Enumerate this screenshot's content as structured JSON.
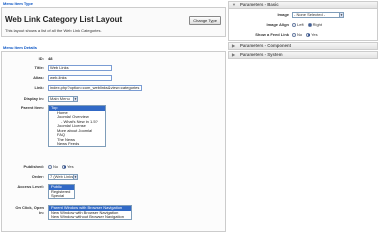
{
  "menu_item_type": {
    "section_title": "Menu Item Type",
    "heading": "Web Link Category List Layout",
    "change_button": "Change Type",
    "description": "This layout shows a list of all the Web Link Categories."
  },
  "menu_item_details": {
    "section_title": "Menu Item Details",
    "id": {
      "label": "ID:",
      "value": "48"
    },
    "title": {
      "label": "Title:",
      "value": "Web Links"
    },
    "alias": {
      "label": "Alias:",
      "value": "web-links"
    },
    "link": {
      "label": "Link:",
      "value": "index.php?option=com_weblinks&view=categories"
    },
    "display_in": {
      "label": "Display in:",
      "value": "Main Menu"
    },
    "parent_item": {
      "label": "Parent Item:",
      "options": [
        {
          "text": "Top",
          "level": 0,
          "selected": true
        },
        {
          "text": "Home",
          "level": 1,
          "selected": false
        },
        {
          "text": "Joomla! Overview",
          "level": 1,
          "selected": false
        },
        {
          "text": "- What's New in 1.5?",
          "level": 2,
          "selected": false
        },
        {
          "text": "Joomla! License",
          "level": 1,
          "selected": false
        },
        {
          "text": "More about Joomla!",
          "level": 1,
          "selected": false
        },
        {
          "text": "FAQ",
          "level": 1,
          "selected": false
        },
        {
          "text": "The News",
          "level": 1,
          "selected": false
        },
        {
          "text": "News Feeds",
          "level": 1,
          "selected": false
        }
      ]
    },
    "published": {
      "label": "Published:",
      "options": [
        "No",
        "Yes"
      ],
      "selected": "Yes"
    },
    "order": {
      "label": "Order:",
      "value": "7 (Web Links)"
    },
    "access_level": {
      "label": "Access Level:",
      "options": [
        {
          "text": "Public",
          "selected": true
        },
        {
          "text": "Registered",
          "selected": false
        },
        {
          "text": "Special",
          "selected": false
        }
      ]
    },
    "on_click": {
      "label_line1": "On Click, Open",
      "label_line2": "in:",
      "options": [
        {
          "text": "Parent Window with Browser Navigation",
          "selected": true
        },
        {
          "text": "New Window with Browser Navigation",
          "selected": false
        },
        {
          "text": "New Window without Browser Navigation",
          "selected": false
        }
      ]
    }
  },
  "parameters": {
    "basic": {
      "title": "Parameters - Basic",
      "image": {
        "label": "Image",
        "value": "- None Selected -"
      },
      "image_align": {
        "label": "Image Align",
        "options": [
          "Left",
          "Right"
        ],
        "selected": "Right"
      },
      "show_feed_link": {
        "label": "Show a Feed Link",
        "options": [
          "No",
          "Yes"
        ],
        "selected": "Yes"
      }
    },
    "component": {
      "title": "Parameters - Component"
    },
    "system": {
      "title": "Parameters - System"
    }
  }
}
